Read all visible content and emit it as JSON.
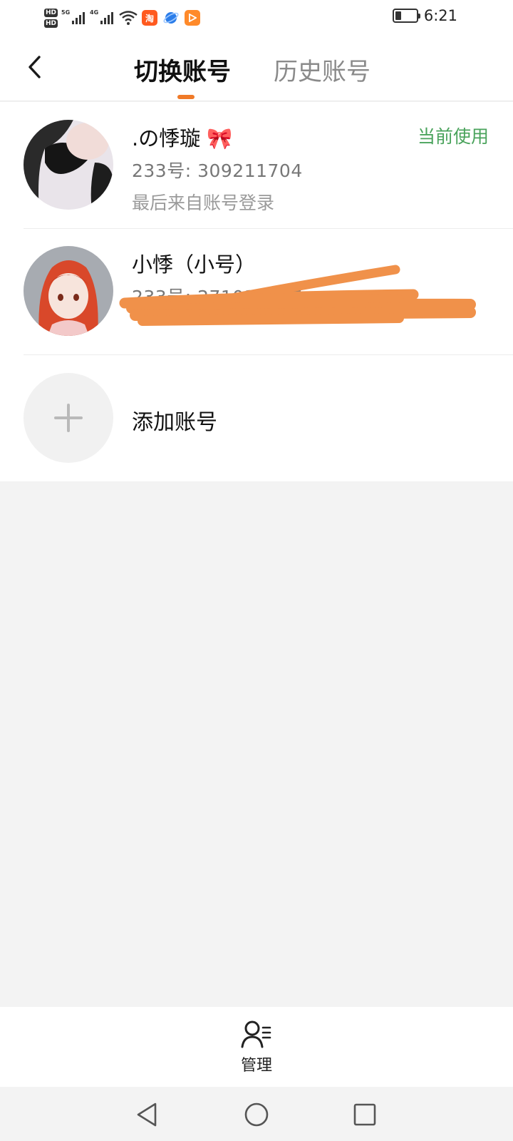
{
  "status_bar": {
    "hd1": "HD",
    "hd2": "HD",
    "net1": "5G",
    "net2": "4G",
    "app1_icon": "taobao-icon",
    "app1_text": "淘",
    "app2_icon": "browser-icon",
    "app3_icon": "video-player-icon",
    "battery_icon": "battery-icon",
    "battery_level": 0.25,
    "time": "6:21"
  },
  "header": {
    "back_icon": "back-arrow-icon",
    "tabs": [
      {
        "label": "切换账号",
        "active": true
      },
      {
        "label": "历史账号",
        "active": false
      }
    ],
    "accent_color": "#f07a28"
  },
  "accounts": [
    {
      "name": ".の悸璇 🎀",
      "id": "233号: 309211704",
      "login_source": "最后来自账号登录",
      "status": "当前使用",
      "avatar_icon": "avatar-dark-hair"
    },
    {
      "name": "小悸（小号）",
      "id": "233号: 271033237",
      "login_source": "",
      "status": "",
      "avatar_icon": "avatar-red-hair"
    }
  ],
  "add_account": {
    "label": "添加账号",
    "icon": "plus-icon"
  },
  "bottom_bar": {
    "manage_label": "管理",
    "manage_icon": "user-manage-icon"
  },
  "nav": {
    "back_icon": "nav-back-icon",
    "home_icon": "nav-home-icon",
    "recents_icon": "nav-recents-icon"
  },
  "colors": {
    "current_status": "#4aa35c",
    "redaction": "#f0914a",
    "background": "#f3f3f3"
  }
}
